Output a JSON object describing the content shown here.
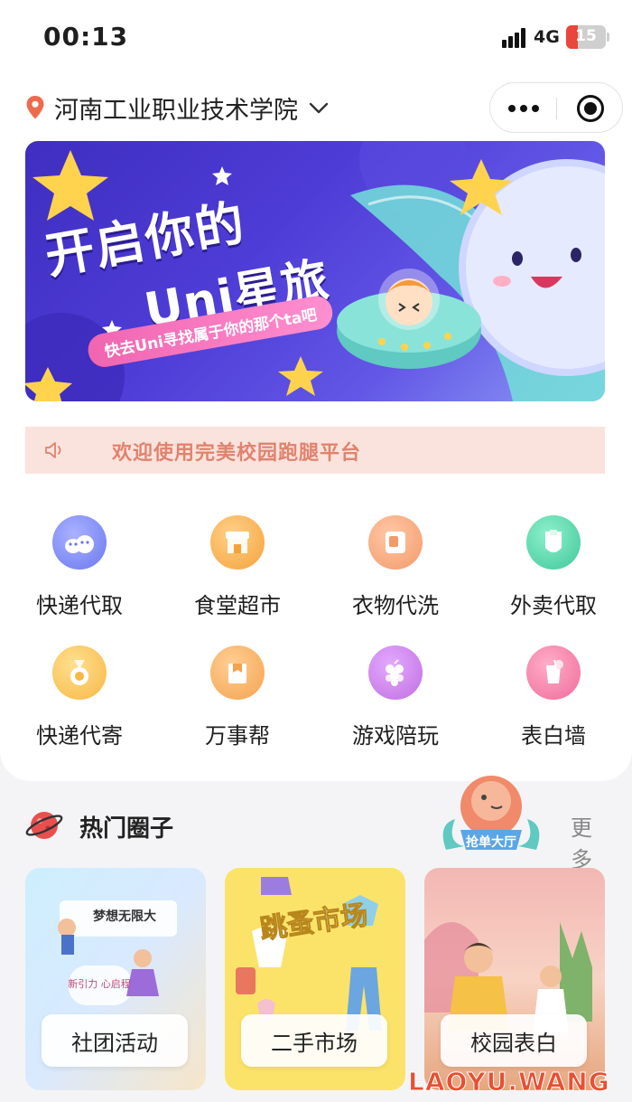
{
  "status_bar": {
    "time": "00:13",
    "network": "4G",
    "battery": "15"
  },
  "header": {
    "location": "河南工业职业技术学院"
  },
  "banner": {
    "title_line1": "开启你的",
    "title_line2": "Uni星旅",
    "subtitle": "快去Uni寻找属于你的那个ta吧"
  },
  "notice": {
    "text": "欢迎使用完美校园跑腿平台"
  },
  "services": [
    {
      "label": "快递代取",
      "icon": "package-icon",
      "color": "#6b78f0"
    },
    {
      "label": "食堂超市",
      "icon": "store-icon",
      "color": "#f5a23a"
    },
    {
      "label": "衣物代洗",
      "icon": "laundry-icon",
      "color": "#f39a6a"
    },
    {
      "label": "外卖代取",
      "icon": "takeout-icon",
      "color": "#3fc79a"
    },
    {
      "label": "快递代寄",
      "icon": "medal-icon",
      "color": "#f7b845"
    },
    {
      "label": "万事帮",
      "icon": "gift-box-icon",
      "color": "#f4a24d"
    },
    {
      "label": "游戏陪玩",
      "icon": "grapes-icon",
      "color": "#c06fe0"
    },
    {
      "label": "表白墙",
      "icon": "drink-icon",
      "color": "#f06b9a"
    }
  ],
  "hot_circles": {
    "title": "热门圈子",
    "more": "更多+",
    "badge": "抢单大厅",
    "cards": [
      {
        "label": "社团活动",
        "poster_title": "梦想无限大",
        "poster_sub": "新引力 心启程"
      },
      {
        "label": "二手市场",
        "poster_title": "跳蚤市场"
      },
      {
        "label": "校园表白"
      }
    ]
  },
  "watermark": "LAOYU.WANG"
}
